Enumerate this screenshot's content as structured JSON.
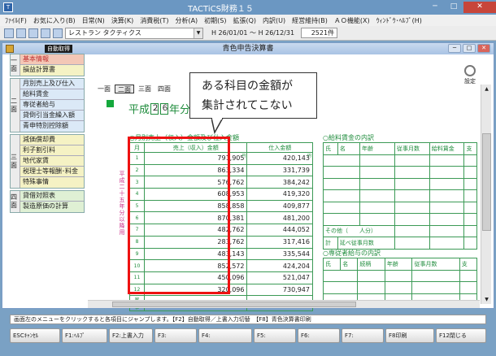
{
  "window": {
    "title": "TACTiCS財務１５",
    "minimize": "─",
    "maximize": "□",
    "close": "✕"
  },
  "menu": [
    "ﾌｧｲﾙ(F)",
    "お気に入り(B)",
    "日常(N)",
    "決算(K)",
    "消費税(T)",
    "分析(A)",
    "初期(S)",
    "拡張(Q)",
    "内訳(U)",
    "経営維持(B)",
    "ＡＯ機能(X)",
    "ｳｨﾝﾄﾞｳ･ﾍﾙﾌﾟ(H)"
  ],
  "toolbar": {
    "combo_value": "レストラン タクティクス",
    "period": "H 26/01/01 ～ H 26/12/31",
    "count": "2521件"
  },
  "doc": {
    "title": "青色申告決算書",
    "jidou_btn": "自動取得",
    "settings_label": "設定"
  },
  "pagetabs": [
    "一面",
    "二面",
    "三面",
    "四面"
  ],
  "nav": [
    {
      "label": "一面",
      "items": [
        "基本情報",
        "損益計算書"
      ],
      "selected": 0
    },
    {
      "label": "二面",
      "items": [
        "月別売上及び仕入",
        "給料賃金",
        "専従者給与",
        "貸倒引当金繰入額",
        "青申特別控除額"
      ]
    },
    {
      "label": "三面",
      "items": [
        "減価償却費",
        "利子割引料",
        "地代家賃",
        "税理士等報酬･料金",
        "特殊事情"
      ]
    },
    {
      "label": "四面",
      "items": [
        "貸借対照表",
        "製造原価の計算"
      ]
    }
  ],
  "heisei": {
    "label": "平成",
    "d1": "２",
    "d2": "６",
    "suffix": "年分"
  },
  "callout": {
    "line1": "ある科目の金額が",
    "line2": "集計されてこない"
  },
  "sections": {
    "monthly": "○月別売上（収入）金額及び仕入金額",
    "salary": "○給料賃金の内訳",
    "senju": "○専従者給与の内訳"
  },
  "vertical_note": "平成二十五年分以降用",
  "monthly_table": {
    "headers": [
      "月",
      "売上（収入）金額",
      "仕入金額"
    ],
    "yen": "円",
    "rows": [
      {
        "m": "1",
        "sales": "791,905",
        "purchase": "420,143"
      },
      {
        "m": "2",
        "sales": "863,334",
        "purchase": "331,739"
      },
      {
        "m": "3",
        "sales": "576,762",
        "purchase": "384,242"
      },
      {
        "m": "4",
        "sales": "608,953",
        "purchase": "419,320"
      },
      {
        "m": "5",
        "sales": "858,858",
        "purchase": "409,877"
      },
      {
        "m": "6",
        "sales": "870,381",
        "purchase": "481,200"
      },
      {
        "m": "7",
        "sales": "482,762",
        "purchase": "444,052"
      },
      {
        "m": "8",
        "sales": "283,762",
        "purchase": "317,416"
      },
      {
        "m": "9",
        "sales": "483,143",
        "purchase": "335,544"
      },
      {
        "m": "10",
        "sales": "852,572",
        "purchase": "424,204"
      },
      {
        "m": "11",
        "sales": "450,096",
        "purchase": "521,047"
      },
      {
        "m": "12",
        "sales": "320,096",
        "purchase": "730,947"
      }
    ],
    "bottom": [
      "家事",
      "消費等"
    ]
  },
  "salary_table": {
    "headers": [
      "氏",
      "名",
      "年齢",
      "従事月数",
      "給料賃金",
      "支"
    ],
    "other_row": "その他（　　人分）",
    "total_row": "計",
    "employees": "延べ従事月数"
  },
  "senju_table": {
    "headers": [
      "氏",
      "名",
      "続柄",
      "年齢",
      "従事月数",
      "支"
    ]
  },
  "status": "画面左のメニューをクリックすると各項目にジャンプします。【F2】自動取得／上書入力切替　【F8】青色決算書印刷",
  "fkeys": [
    "ESCｷｬﾝｾﾙ",
    "F1:ﾍﾙﾌﾟ",
    "F2:上書入力",
    "F3:",
    "F4:",
    "F5:",
    "F6:",
    "F7:",
    "F8印刷",
    "F12閉じる"
  ],
  "colors": {
    "accent_red": "#e11111",
    "form_green": "#1f8c3c"
  }
}
